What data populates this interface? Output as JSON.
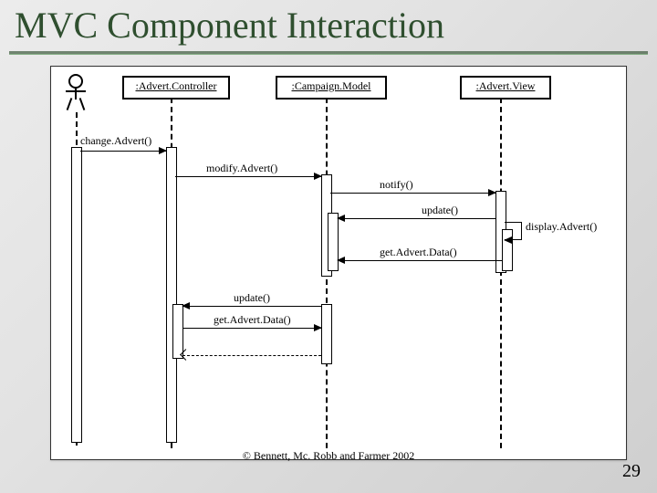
{
  "title": "MVC Component Interaction",
  "credit": "© Bennett, Mc. Robb and Farmer 2002",
  "pagenum": "29",
  "chart_data": {
    "type": "sequence-diagram",
    "participants": [
      {
        "id": "user",
        "kind": "actor",
        "label": ""
      },
      {
        "id": "ctrl",
        "kind": "object",
        "label": ":Advert.Controller"
      },
      {
        "id": "model",
        "kind": "object",
        "label": ":Campaign.Model"
      },
      {
        "id": "view",
        "kind": "object",
        "label": ":Advert.View"
      }
    ],
    "messages": [
      {
        "id": "m1",
        "from": "user",
        "to": "ctrl",
        "label": "change.Advert()",
        "kind": "sync"
      },
      {
        "id": "m2",
        "from": "ctrl",
        "to": "model",
        "label": "modify.Advert()",
        "kind": "sync"
      },
      {
        "id": "m3",
        "from": "model",
        "to": "view",
        "label": "notify()",
        "kind": "sync"
      },
      {
        "id": "m4",
        "from": "view",
        "to": "model",
        "label": "update()",
        "kind": "sync"
      },
      {
        "id": "m5",
        "from": "view",
        "to": "view",
        "label": "display.Advert()",
        "kind": "self"
      },
      {
        "id": "m6",
        "from": "view",
        "to": "model",
        "label": "get.Advert.Data()",
        "kind": "sync"
      },
      {
        "id": "m7",
        "from": "model",
        "to": "ctrl",
        "label": "update()",
        "kind": "sync"
      },
      {
        "id": "m8",
        "from": "ctrl",
        "to": "model",
        "label": "get.Advert.Data()",
        "kind": "sync"
      },
      {
        "id": "m9",
        "from": "model",
        "to": "ctrl",
        "label": "",
        "kind": "return"
      }
    ]
  }
}
